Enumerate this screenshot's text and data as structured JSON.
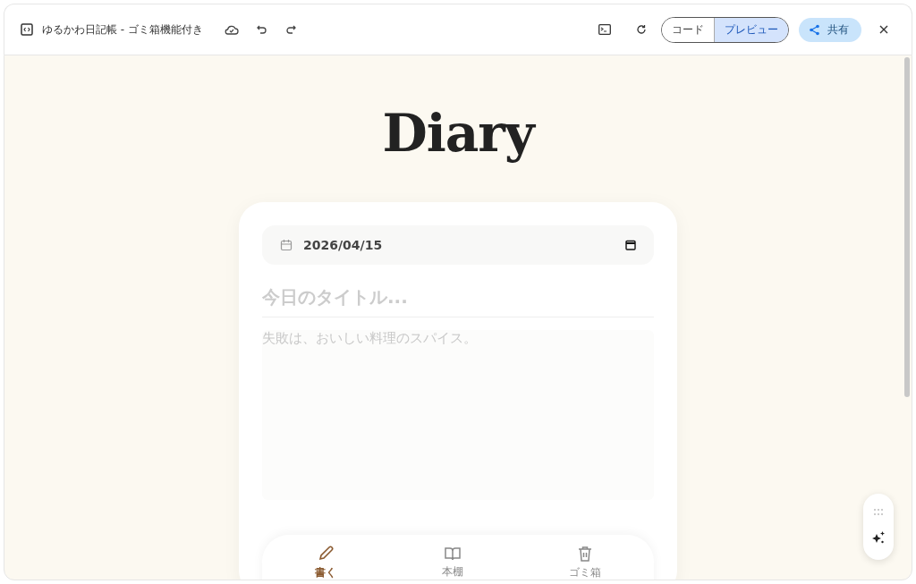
{
  "window": {
    "title": "ゆるかわ日記帳 - ゴミ箱機能付き"
  },
  "view_toggle": [
    {
      "label": "コード",
      "selected": false
    },
    {
      "label": "プレビュー",
      "selected": true
    }
  ],
  "share_button": {
    "label": "共有"
  },
  "app": {
    "heading": "Diary",
    "date_field": {
      "value": "2026/04/15"
    },
    "title_field": {
      "placeholder": "今日のタイトル..."
    },
    "body_field": {
      "placeholder": "失敗は、おいしい料理のスパイス。"
    },
    "nav": [
      {
        "kind": "write",
        "label": "書く",
        "selected": true
      },
      {
        "kind": "shelf",
        "label": "本棚",
        "selected": false
      },
      {
        "kind": "trash",
        "label": "ゴミ箱",
        "selected": false
      }
    ]
  }
}
